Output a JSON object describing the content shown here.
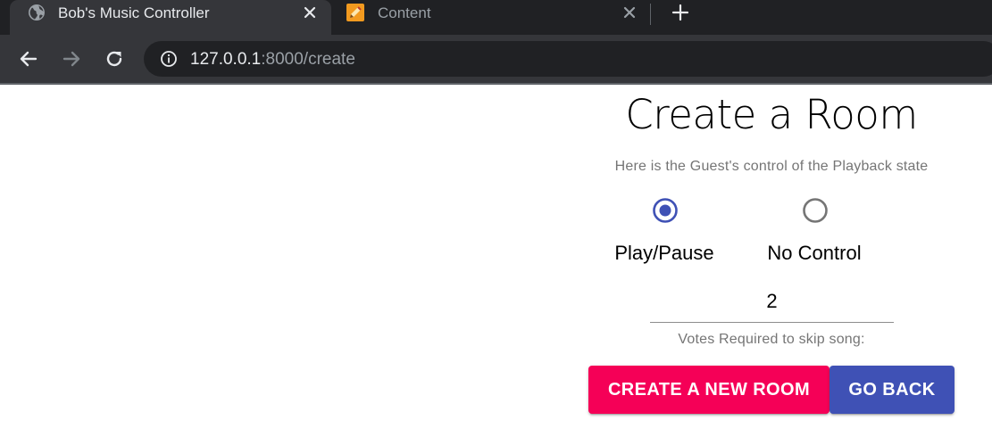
{
  "browser": {
    "tabs": [
      {
        "title": "Bob's Music Controller",
        "favicon": "globe-icon",
        "active": true
      },
      {
        "title": "Content",
        "favicon": "pencil-icon",
        "active": false
      }
    ],
    "url": {
      "host": "127.0.0.1",
      "path": ":8000/create"
    }
  },
  "page": {
    "title": "Create a Room",
    "helper_text": "Here is the Guest's control of the Playback state",
    "guest_control": {
      "options": [
        {
          "label": "Play/Pause",
          "selected": true
        },
        {
          "label": "No Control",
          "selected": false
        }
      ]
    },
    "votes": {
      "value": "2",
      "caption": "Votes Required to skip song:"
    },
    "buttons": {
      "create": "CREATE A NEW ROOM",
      "back": "GO BACK"
    }
  },
  "colors": {
    "primary": "#3f51b5",
    "secondary": "#f50057",
    "radio_unselected": "#757575"
  }
}
